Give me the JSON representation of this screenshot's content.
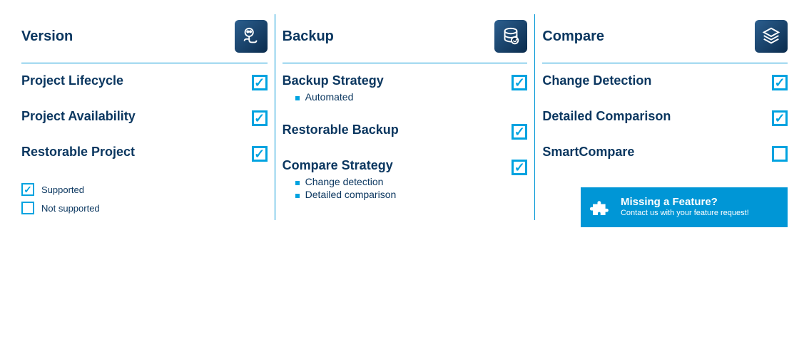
{
  "columns": [
    {
      "title": "Version",
      "icon": "robot-icon",
      "features": [
        {
          "label": "Project Lifecycle",
          "supported": true,
          "sub": []
        },
        {
          "label": "Project Availability",
          "supported": true,
          "sub": []
        },
        {
          "label": "Restorable Project",
          "supported": true,
          "sub": []
        }
      ]
    },
    {
      "title": "Backup",
      "icon": "database-icon",
      "features": [
        {
          "label": "Backup Strategy",
          "supported": true,
          "sub": [
            "Automated"
          ]
        },
        {
          "label": "Restorable Backup",
          "supported": true,
          "sub": []
        },
        {
          "label": "Compare Strategy",
          "supported": true,
          "sub": [
            "Change detection",
            "Detailed comparison"
          ]
        }
      ]
    },
    {
      "title": "Compare",
      "icon": "layers-icon",
      "features": [
        {
          "label": "Change Detection",
          "supported": true,
          "sub": []
        },
        {
          "label": "Detailed Comparison",
          "supported": true,
          "sub": []
        },
        {
          "label": "SmartCompare",
          "supported": false,
          "sub": []
        }
      ]
    }
  ],
  "legend": {
    "supported": "Supported",
    "not_supported": "Not supported"
  },
  "cta": {
    "title": "Missing a Feature?",
    "sub": "Contact us with your feature request!"
  }
}
